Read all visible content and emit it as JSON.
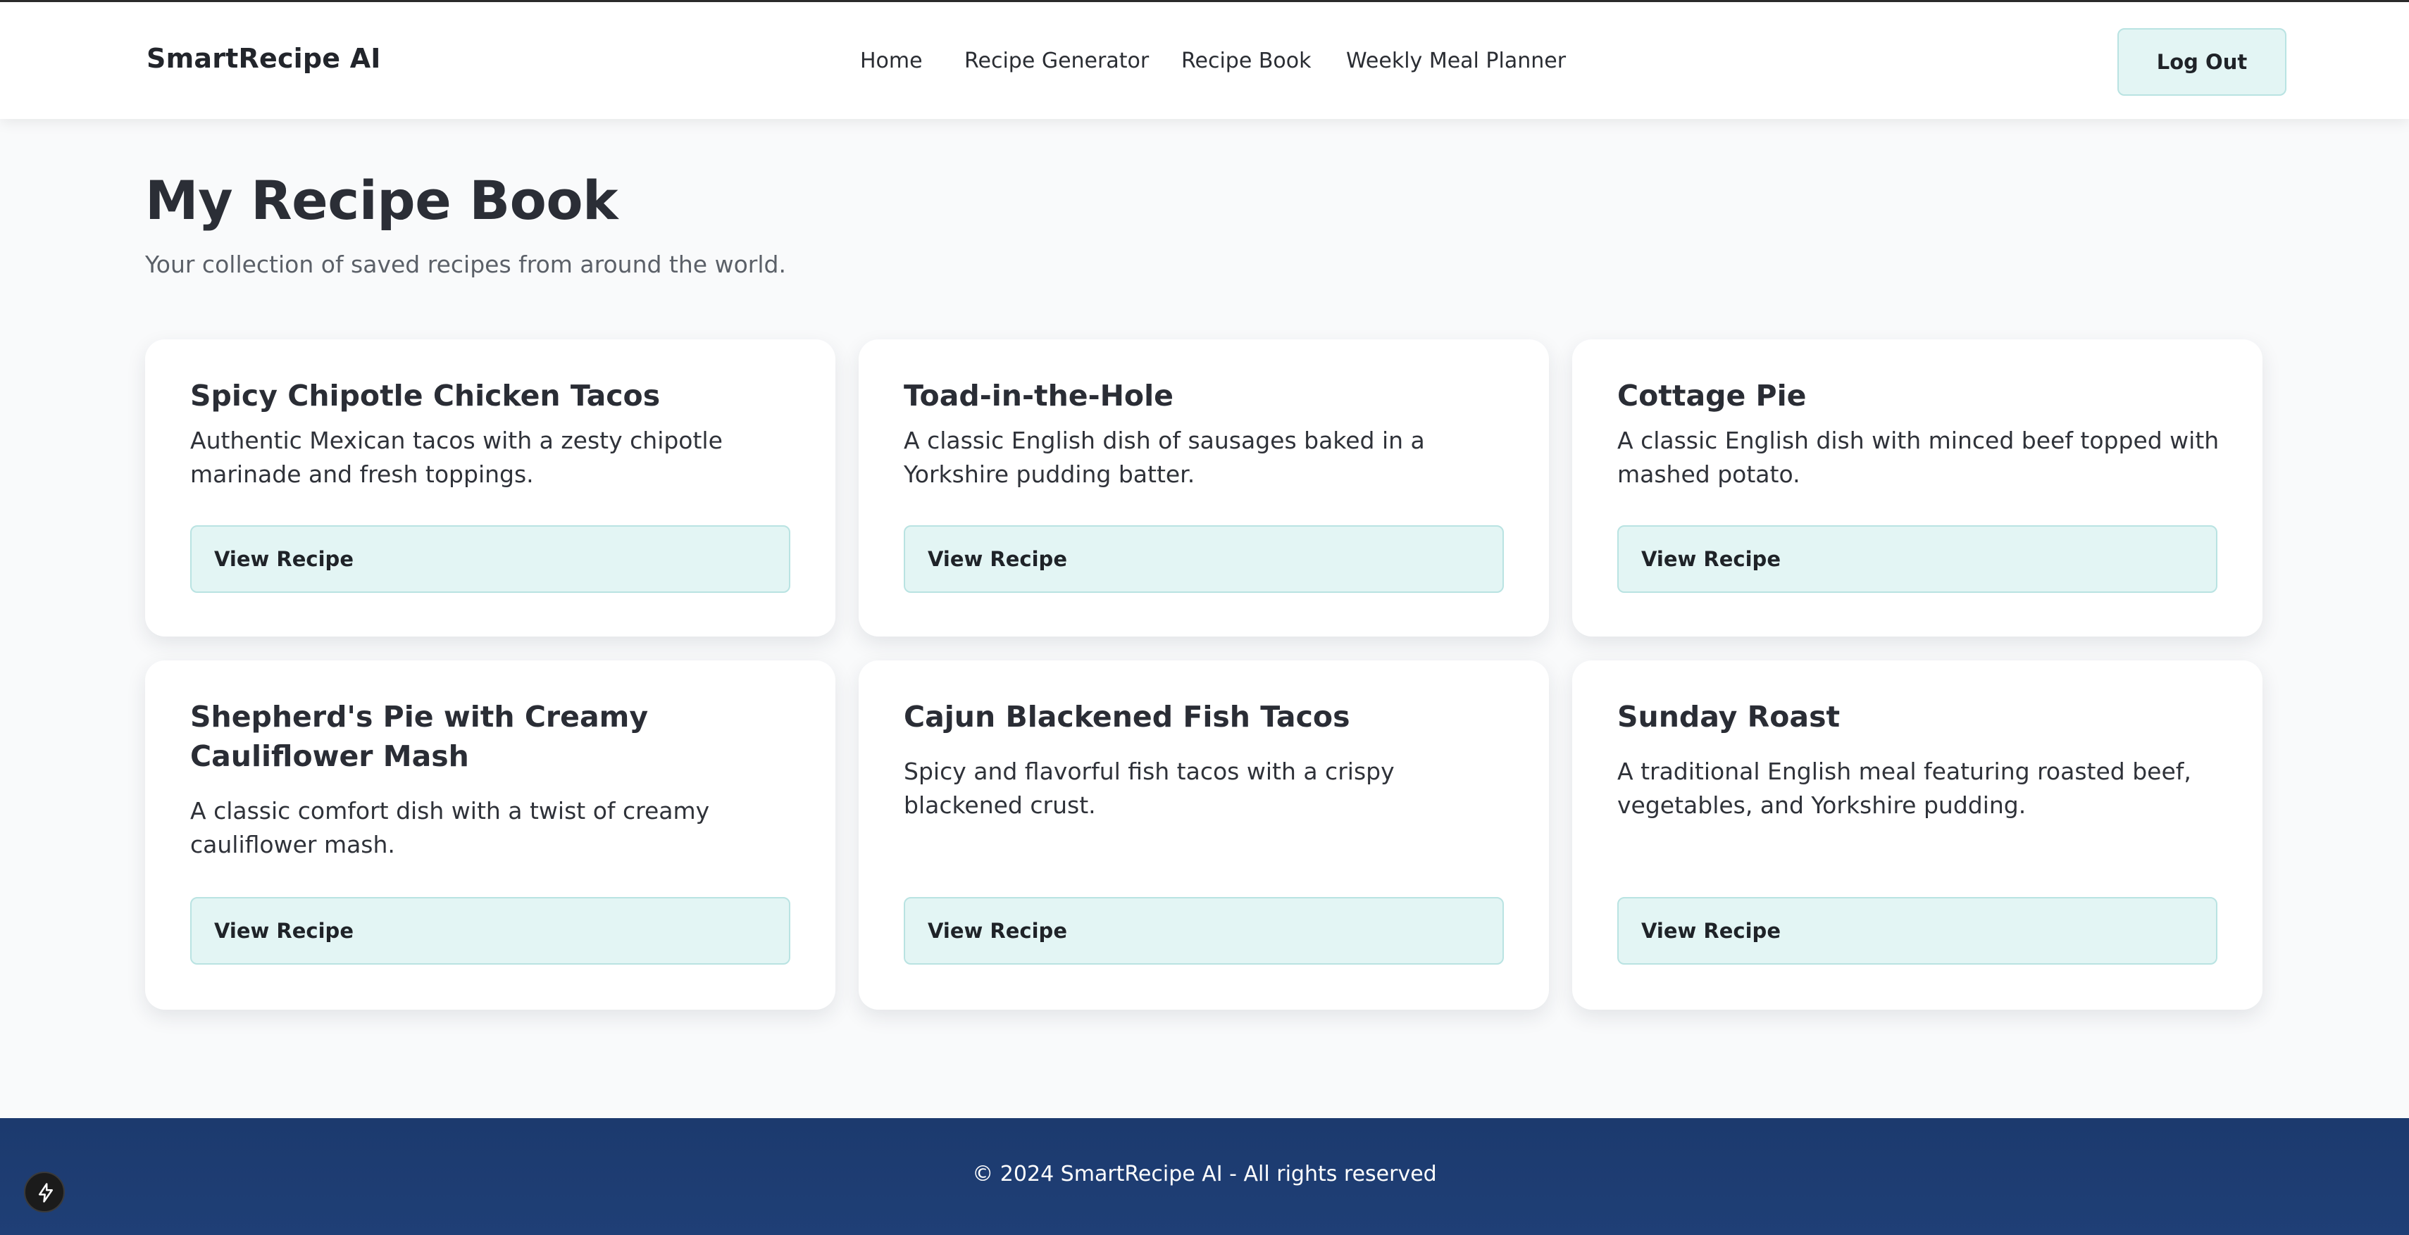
{
  "brand": "SmartRecipe AI",
  "nav": [
    {
      "label": "Home"
    },
    {
      "label": "Recipe Generator"
    },
    {
      "label": "Recipe Book"
    },
    {
      "label": "Weekly Meal Planner"
    }
  ],
  "auth": {
    "logout_label": "Log Out"
  },
  "page": {
    "title": "My Recipe Book",
    "subtitle": "Your collection of saved recipes from around the world."
  },
  "recipes": [
    {
      "title": "Spicy Chipotle Chicken Tacos",
      "description": "Authentic Mexican tacos with a zesty chipotle marinade and fresh toppings.",
      "button": "View Recipe"
    },
    {
      "title": "Toad-in-the-Hole",
      "description": "A classic English dish of sausages baked in a Yorkshire pudding batter.",
      "button": "View Recipe"
    },
    {
      "title": "Cottage Pie",
      "description": "A classic English dish with minced beef topped with mashed potato.",
      "button": "View Recipe"
    },
    {
      "title": "Shepherd's Pie with Creamy Cauliflower Mash",
      "description": "A classic comfort dish with a twist of creamy cauliflower mash.",
      "button": "View Recipe"
    },
    {
      "title": "Cajun Blackened Fish Tacos",
      "description": "Spicy and flavorful fish tacos with a crispy blackened crust.",
      "button": "View Recipe"
    },
    {
      "title": "Sunday Roast",
      "description": "A traditional English meal featuring roasted beef, vegetables, and Yorkshire pudding.",
      "button": "View Recipe"
    }
  ],
  "footer": {
    "text": "© 2024 SmartRecipe AI - All rights reserved"
  },
  "colors": {
    "accent_button_bg": "#e3f5f4",
    "accent_button_border": "#b9e3e2",
    "footer_bg": "#1c3a6e"
  },
  "icons": {
    "dev_badge": "lightning-bolt-icon"
  }
}
